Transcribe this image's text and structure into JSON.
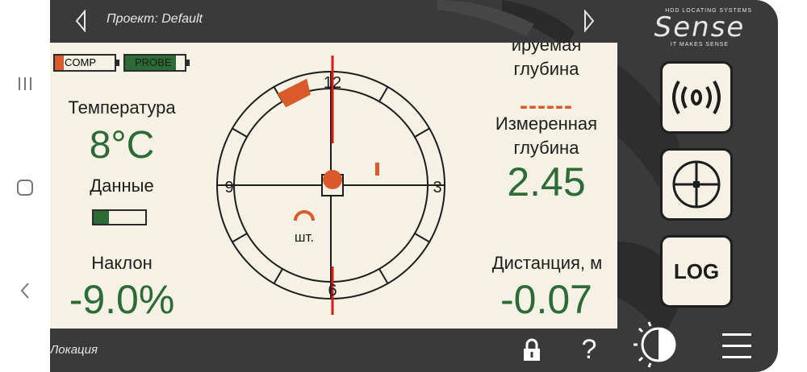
{
  "topbar": {
    "project_title": "Проект: Default"
  },
  "logo": {
    "line1": "HDD LOCATING SYSTEMS",
    "word": "Sense",
    "line2": "IT MAKES SENSE"
  },
  "batteries": {
    "comp": {
      "label": "COMP",
      "level": 0.15,
      "color": "#d95a2b"
    },
    "probe": {
      "label": "PROBE",
      "level": 0.85,
      "color": "#2c6b35"
    }
  },
  "left_readouts": {
    "temperature_label": "Температура",
    "temperature_value": "8°C",
    "data_label": "Данные",
    "data_level": 0.3,
    "pitch_label": "Наклон",
    "pitch_value": "-9.0%"
  },
  "dial": {
    "label_12": "12",
    "label_3": "3",
    "label_6": "6",
    "label_9": "9",
    "probe_label": "шт."
  },
  "right_readouts": {
    "predicted_depth_label_line1": "ируемая",
    "predicted_depth_label_line2": "глубина",
    "predicted_depth_value": "------",
    "measured_depth_label_line1": "Измеренная",
    "measured_depth_label_line2": "глубина",
    "measured_depth_value": "2.45",
    "distance_label": "Дистанция, м",
    "distance_value": "-0.07"
  },
  "side_buttons": {
    "log_label": "LOG"
  },
  "bottombar": {
    "mode_label": "Локация",
    "help_glyph": "?"
  },
  "colors": {
    "accent_orange": "#d95a2b",
    "green": "#2c6b35",
    "red_line": "#d91e18",
    "panel_bg": "#f5f1e4",
    "app_bg": "#3a3a3a"
  }
}
